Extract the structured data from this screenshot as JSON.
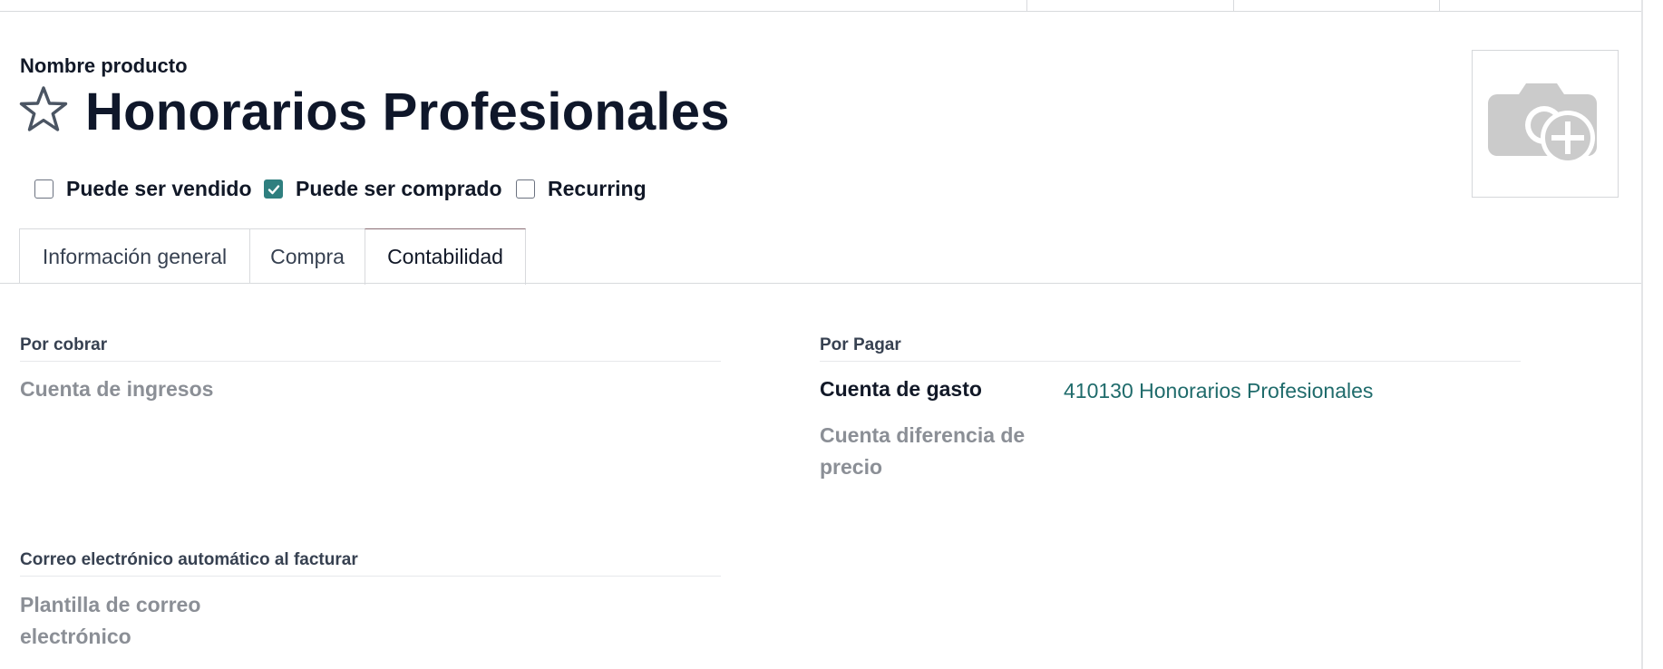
{
  "header": {
    "name_label": "Nombre producto",
    "title": "Honorarios Profesionales"
  },
  "options": [
    {
      "label": "Puede ser vendido",
      "checked": false
    },
    {
      "label": "Puede ser comprado",
      "checked": true
    },
    {
      "label": "Recurring",
      "checked": false
    }
  ],
  "tabs": [
    {
      "label": "Información general",
      "active": false
    },
    {
      "label": "Compra",
      "active": false
    },
    {
      "label": "Contabilidad",
      "active": true
    }
  ],
  "receivable": {
    "title": "Por cobrar",
    "income_account_label": "Cuenta de ingresos"
  },
  "payable": {
    "title": "Por Pagar",
    "expense_account_label": "Cuenta de gasto",
    "expense_account_value": "410130 Honorarios Profesionales",
    "price_diff_label_line1": "Cuenta diferencia de",
    "price_diff_label_line2": "precio"
  },
  "auto_email": {
    "title": "Correo electrónico automático al facturar",
    "template_label_line1": "Plantilla de correo",
    "template_label_line2": "electrónico"
  },
  "colors": {
    "accent": "#2f7f7f",
    "link": "#1f6b6b",
    "muted_label": "#8b8f96"
  },
  "icons": {
    "favorite": "star-outline-icon",
    "photo": "camera-plus-icon",
    "check": "checkmark-icon"
  }
}
